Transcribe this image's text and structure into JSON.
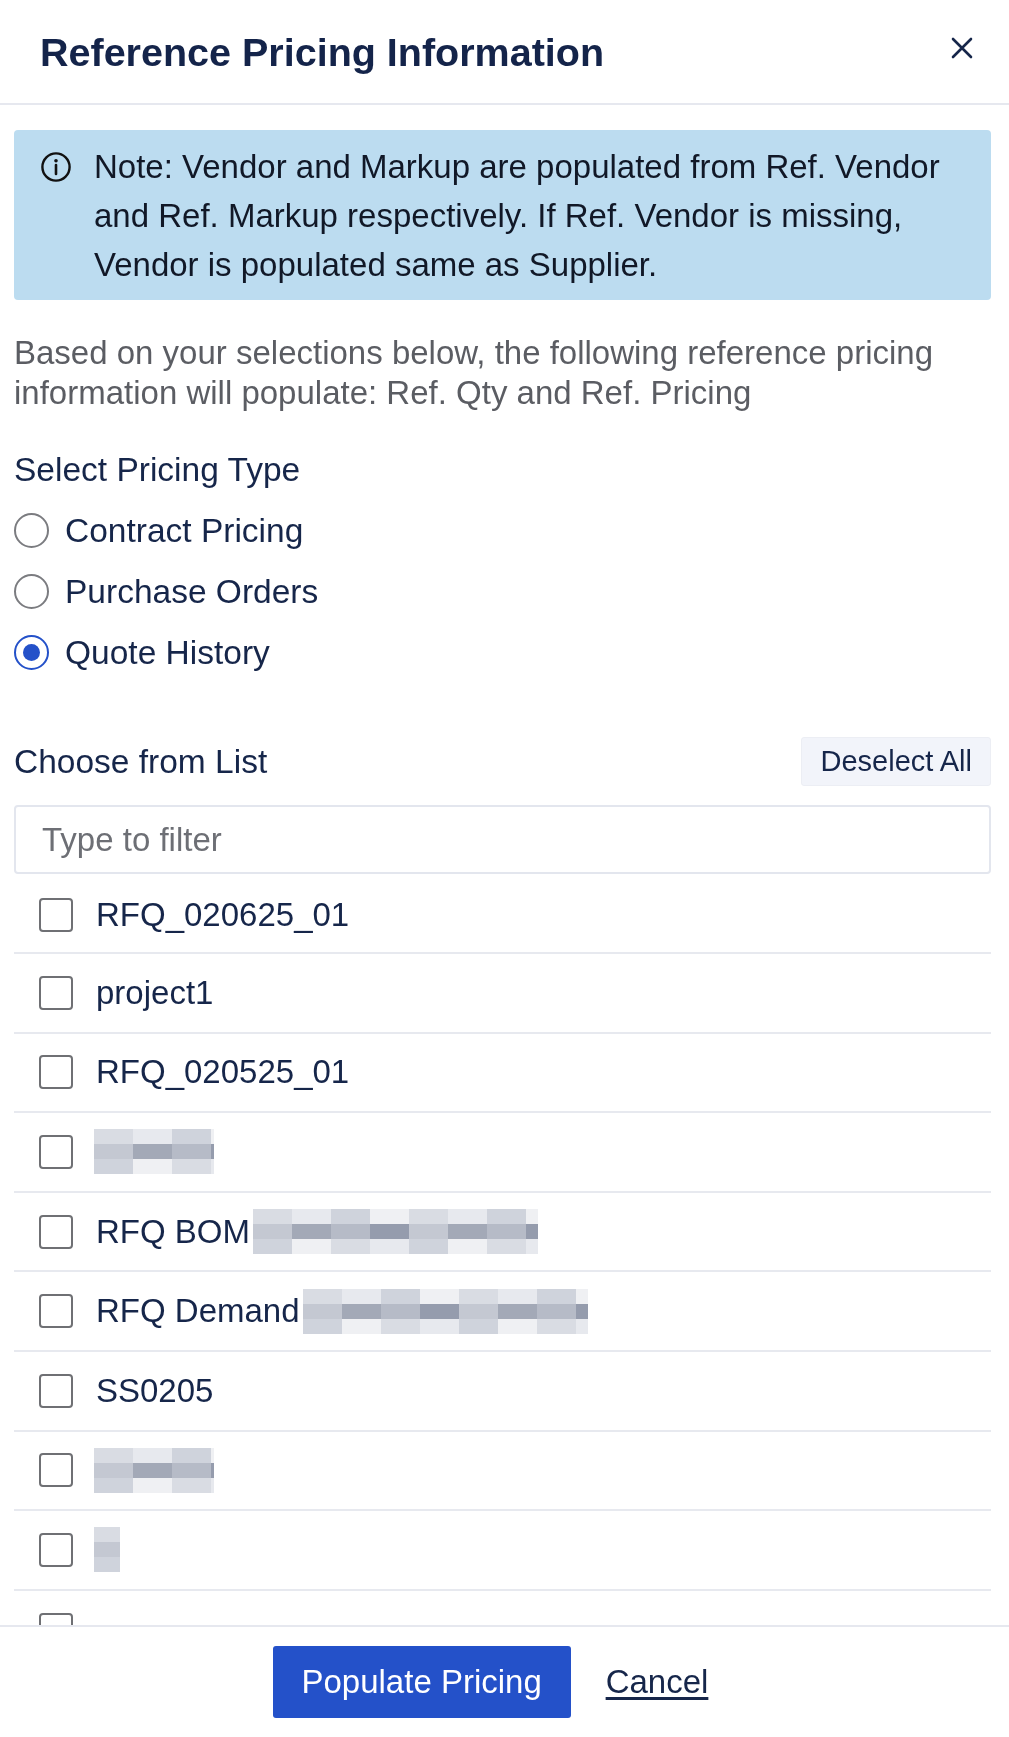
{
  "dialog": {
    "title": "Reference Pricing Information"
  },
  "note": {
    "text": "Note: Vendor and Markup are populated from Ref. Vendor and Ref. Markup respectively. If Ref. Vendor is missing, Vendor is populated same as Supplier."
  },
  "description": "Based on your selections below, the following reference pricing information will populate: Ref. Qty and Ref. Pricing",
  "pricing_type": {
    "label": "Select Pricing Type",
    "options": [
      {
        "label": "Contract Pricing",
        "selected": false
      },
      {
        "label": "Purchase Orders",
        "selected": false
      },
      {
        "label": "Quote History",
        "selected": true
      }
    ]
  },
  "list": {
    "label": "Choose from List",
    "deselect_button": "Deselect All",
    "filter": {
      "placeholder": "Type to filter"
    },
    "items": [
      {
        "kind": "plain",
        "label": "RFQ_020625_01",
        "checked": false
      },
      {
        "kind": "plain",
        "label": "project1",
        "checked": false
      },
      {
        "kind": "plain",
        "label": "RFQ_020525_01",
        "checked": false
      },
      {
        "kind": "blurred",
        "checked": false
      },
      {
        "kind": "blurtail",
        "label": "RFQ BOM",
        "checked": false
      },
      {
        "kind": "blurtail",
        "label": "RFQ Demand",
        "checked": false
      },
      {
        "kind": "plain",
        "label": "SS0205",
        "checked": false
      },
      {
        "kind": "blurred",
        "checked": false
      },
      {
        "kind": "blurdot",
        "checked": false
      },
      {
        "kind": "plain",
        "checked": false
      }
    ]
  },
  "footer": {
    "primary_button": "Populate Pricing",
    "cancel_link": "Cancel"
  }
}
